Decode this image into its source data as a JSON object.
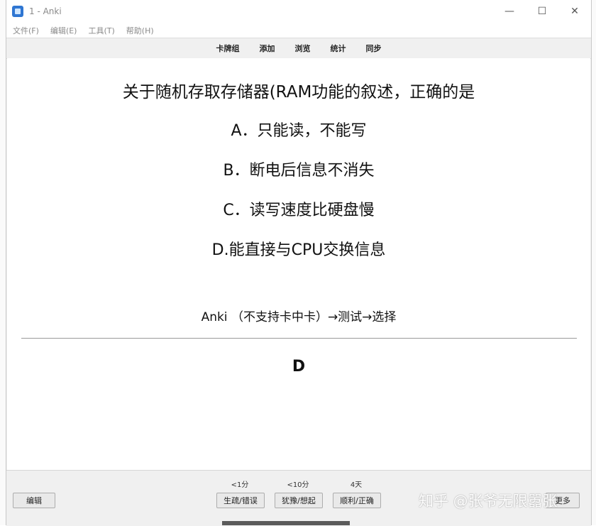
{
  "window": {
    "title": "1 - Anki"
  },
  "title_controls": {
    "minimize": "—",
    "maximize": "☐",
    "close": "✕"
  },
  "menu": [
    "文件(F)",
    "编辑(E)",
    "工具(T)",
    "帮助(H)"
  ],
  "toolbar": [
    "卡牌组",
    "添加",
    "浏览",
    "统计",
    "同步"
  ],
  "card": {
    "question": "关于随机存取存储器(RAM功能的叙述，正确的是",
    "options": [
      "A．只能读，不能写",
      "B．断电后信息不消失",
      "C．读写速度比硬盘慢",
      "D.能直接与CPU交换信息"
    ],
    "tags": "Anki （不支持卡中卡）→测试→选择",
    "answer": "D"
  },
  "bottom": {
    "edit_label": "编辑",
    "intervals": [
      "<1分",
      "<10分",
      "4天"
    ],
    "answers": [
      "生疏/错误",
      "犹豫/想起",
      "顺利/正确"
    ],
    "more_label": "更多"
  },
  "watermark": "知乎 @张爷无限嚣张"
}
